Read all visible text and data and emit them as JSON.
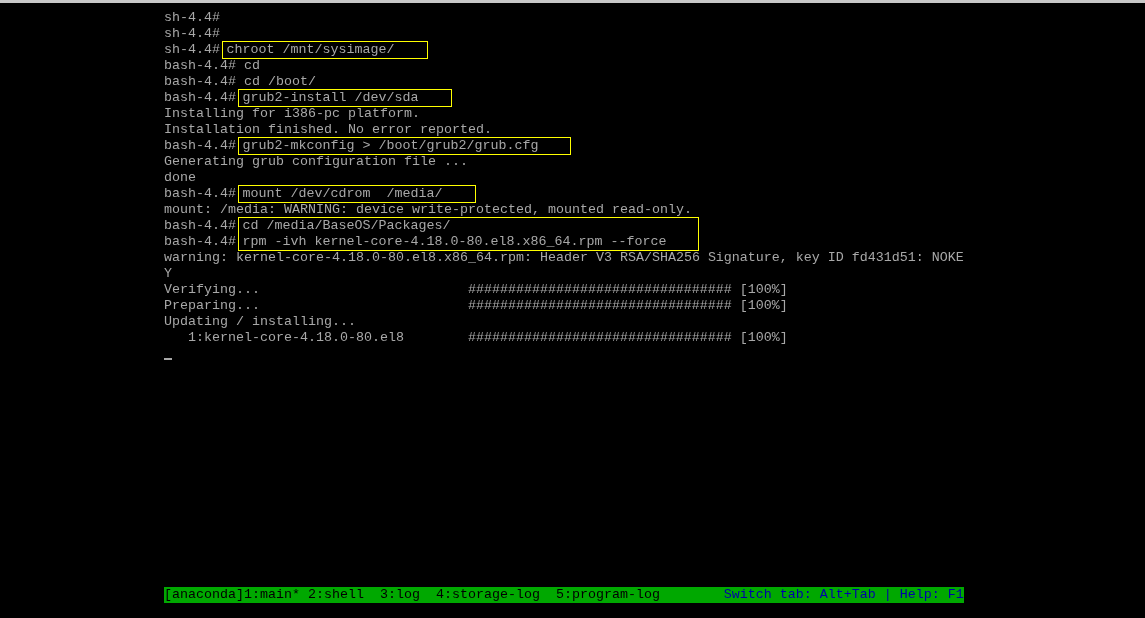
{
  "terminal": {
    "lines": [
      {
        "kind": "plain",
        "prompt": "sh-4.4#"
      },
      {
        "kind": "plain",
        "prompt": "sh-4.4#"
      },
      {
        "kind": "boxed",
        "items": [
          {
            "prompt": "sh-4.4#",
            "command": "chroot /mnt/sysimage/"
          }
        ]
      },
      {
        "kind": "plain",
        "prompt": "bash-4.4#",
        "command": "cd"
      },
      {
        "kind": "plain",
        "prompt": "bash-4.4#",
        "command": "cd /boot/"
      },
      {
        "kind": "boxed",
        "items": [
          {
            "prompt": "bash-4.4#",
            "command": "grub2-install /dev/sda"
          }
        ]
      },
      {
        "kind": "output",
        "text": "Installing for i386-pc platform."
      },
      {
        "kind": "output",
        "text": "Installation finished. No error reported."
      },
      {
        "kind": "boxed",
        "items": [
          {
            "prompt": "bash-4.4#",
            "command": "grub2-mkconfig > /boot/grub2/grub.cfg"
          }
        ]
      },
      {
        "kind": "output",
        "text": "Generating grub configuration file ..."
      },
      {
        "kind": "output",
        "text": "done"
      },
      {
        "kind": "boxed",
        "items": [
          {
            "prompt": "bash-4.4#",
            "command": "mount /dev/cdrom  /media/"
          }
        ]
      },
      {
        "kind": "output",
        "text": "mount: /media: WARNING: device write-protected, mounted read-only."
      },
      {
        "kind": "boxed",
        "items": [
          {
            "prompt": "bash-4.4#",
            "command": "cd /media/BaseOS/Packages/"
          },
          {
            "prompt": "bash-4.4#",
            "command": "rpm -ivh kernel-core-4.18.0-80.el8.x86_64.rpm --force"
          }
        ]
      },
      {
        "kind": "output",
        "text": "warning: kernel-core-4.18.0-80.el8.x86_64.rpm: Header V3 RSA/SHA256 Signature, key ID fd431d51: NOKE"
      },
      {
        "kind": "output",
        "text": "Y"
      },
      {
        "kind": "progress",
        "label": "Verifying...",
        "bar": "#################################",
        "percent": "[100%]"
      },
      {
        "kind": "progress",
        "label": "Preparing...",
        "bar": "#################################",
        "percent": "[100%]"
      },
      {
        "kind": "output",
        "text": "Updating / installing..."
      },
      {
        "kind": "progress",
        "label": "   1:kernel-core-4.18.0-80.el8",
        "bar": "#################################",
        "percent": "[100%]"
      },
      {
        "kind": "cursor"
      }
    ]
  },
  "status_bar": {
    "windows": "[anaconda]1:main* 2:shell  3:log  4:storage-log  5:program-log",
    "hint": "Switch tab: Alt+Tab | Help: F1"
  }
}
